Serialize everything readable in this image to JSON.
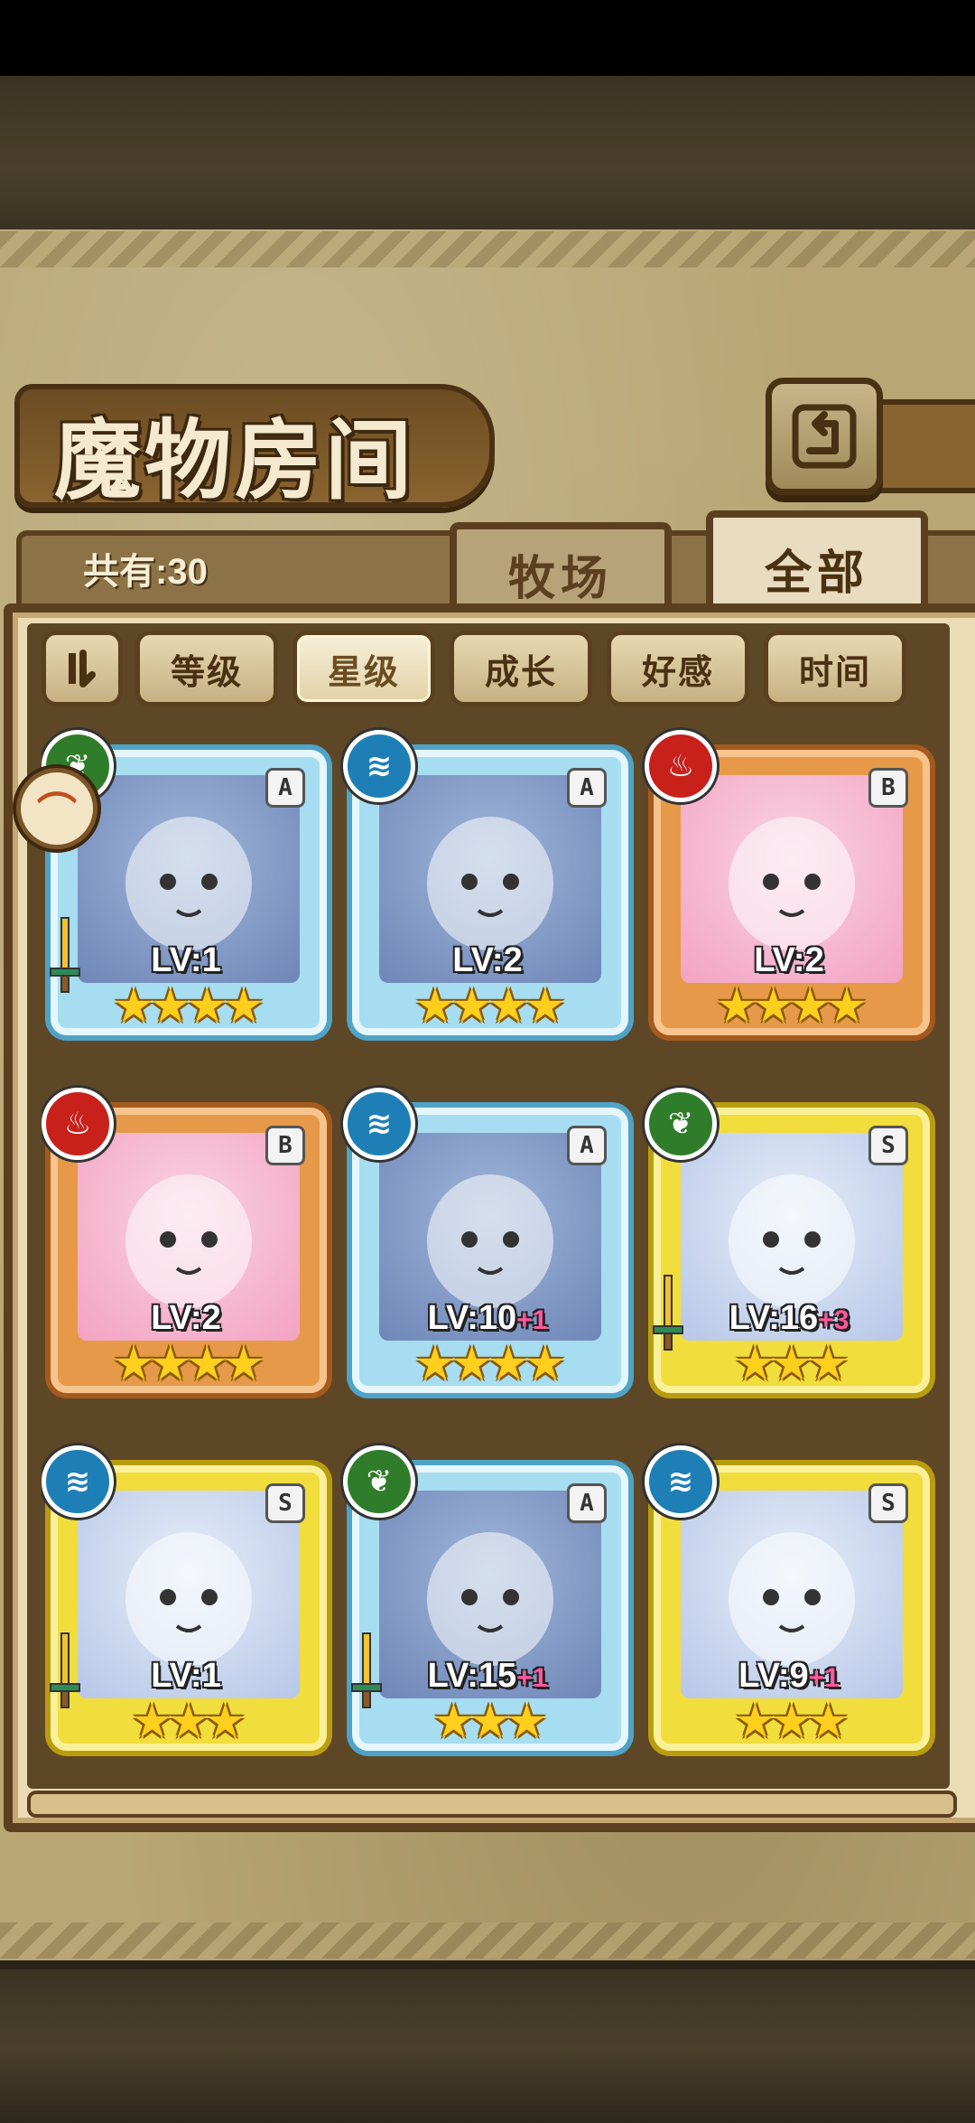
{
  "header": {
    "title": "魔物房间",
    "count_label": "共有:30",
    "tabs": [
      {
        "label": "牧场",
        "active": false
      },
      {
        "label": "全部",
        "active": true
      }
    ]
  },
  "filters": {
    "toggle_icon": "sort-toggle-icon",
    "buttons": [
      {
        "label": "等级",
        "active": false
      },
      {
        "label": "星级",
        "active": true
      },
      {
        "label": "成长",
        "active": false
      },
      {
        "label": "好感",
        "active": false
      },
      {
        "label": "时间",
        "active": false
      }
    ]
  },
  "monsters": [
    {
      "level": "LV:1",
      "bonus": "",
      "rank": "A",
      "element": "wood",
      "stars": 4,
      "weapon": true
    },
    {
      "level": "LV:2",
      "bonus": "",
      "rank": "A",
      "element": "water",
      "stars": 4,
      "weapon": false
    },
    {
      "level": "LV:2",
      "bonus": "",
      "rank": "B",
      "element": "fire",
      "stars": 4,
      "weapon": false
    },
    {
      "level": "LV:2",
      "bonus": "",
      "rank": "B",
      "element": "fire",
      "stars": 4,
      "weapon": false
    },
    {
      "level": "LV:10",
      "bonus": "+1",
      "rank": "A",
      "element": "water",
      "stars": 4,
      "weapon": false
    },
    {
      "level": "LV:16",
      "bonus": "+3",
      "rank": "S",
      "element": "wood",
      "stars": 3,
      "weapon": true
    },
    {
      "level": "LV:1",
      "bonus": "",
      "rank": "S",
      "element": "water",
      "stars": 3,
      "weapon": true
    },
    {
      "level": "LV:15",
      "bonus": "+1",
      "rank": "A",
      "element": "wood",
      "stars": 3,
      "weapon": true
    },
    {
      "level": "LV:9",
      "bonus": "+1",
      "rank": "S",
      "element": "water",
      "stars": 3,
      "weapon": false
    }
  ],
  "colors": {
    "water": "#1e7fb6",
    "fire": "#c8211c",
    "wood": "#2f7d2a",
    "star": "#ffcf1e"
  }
}
